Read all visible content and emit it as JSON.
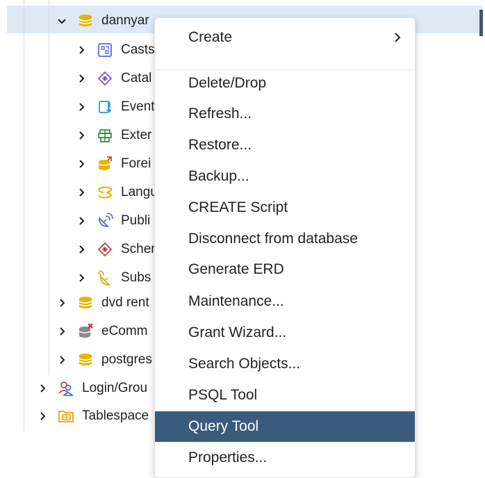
{
  "tree": {
    "items": [
      {
        "label": "dannyar",
        "expanded": true,
        "icon": "database-icon"
      },
      {
        "label": "Casts",
        "icon": "cast-icon"
      },
      {
        "label": "Catal",
        "icon": "catalog-icon"
      },
      {
        "label": "Event",
        "icon": "event-trigger-icon"
      },
      {
        "label": "Exter",
        "icon": "extension-icon"
      },
      {
        "label": "Forei",
        "icon": "foreign-data-wrapper-icon"
      },
      {
        "label": "Langu",
        "icon": "language-icon"
      },
      {
        "label": "Publi",
        "icon": "publication-icon"
      },
      {
        "label": "Scher",
        "icon": "schema-icon"
      },
      {
        "label": "Subs",
        "icon": "subscription-icon"
      },
      {
        "label": "dvd rent",
        "icon": "database-icon"
      },
      {
        "label": "eComm",
        "icon": "database-disconnected-icon"
      },
      {
        "label": "postgres",
        "icon": "database-icon"
      },
      {
        "label": "Login/Grou",
        "icon": "login-roles-icon"
      },
      {
        "label": "Tablespace",
        "icon": "tablespace-icon"
      }
    ]
  },
  "context_menu": {
    "items": [
      {
        "label": "Create",
        "has_submenu": true
      },
      {
        "label": "Delete/Drop"
      },
      {
        "label": "Refresh..."
      },
      {
        "label": "Restore..."
      },
      {
        "label": "Backup..."
      },
      {
        "label": "CREATE Script"
      },
      {
        "label": "Disconnect from database"
      },
      {
        "label": "Generate ERD"
      },
      {
        "label": "Maintenance..."
      },
      {
        "label": "Grant Wizard..."
      },
      {
        "label": "Search Objects..."
      },
      {
        "label": "PSQL Tool"
      },
      {
        "label": "Query Tool",
        "active": true
      },
      {
        "label": "Properties..."
      }
    ]
  },
  "colors": {
    "selection": "#dfe9f6",
    "menu_active": "#3b5b7d",
    "db_icon": "#e8b400"
  }
}
